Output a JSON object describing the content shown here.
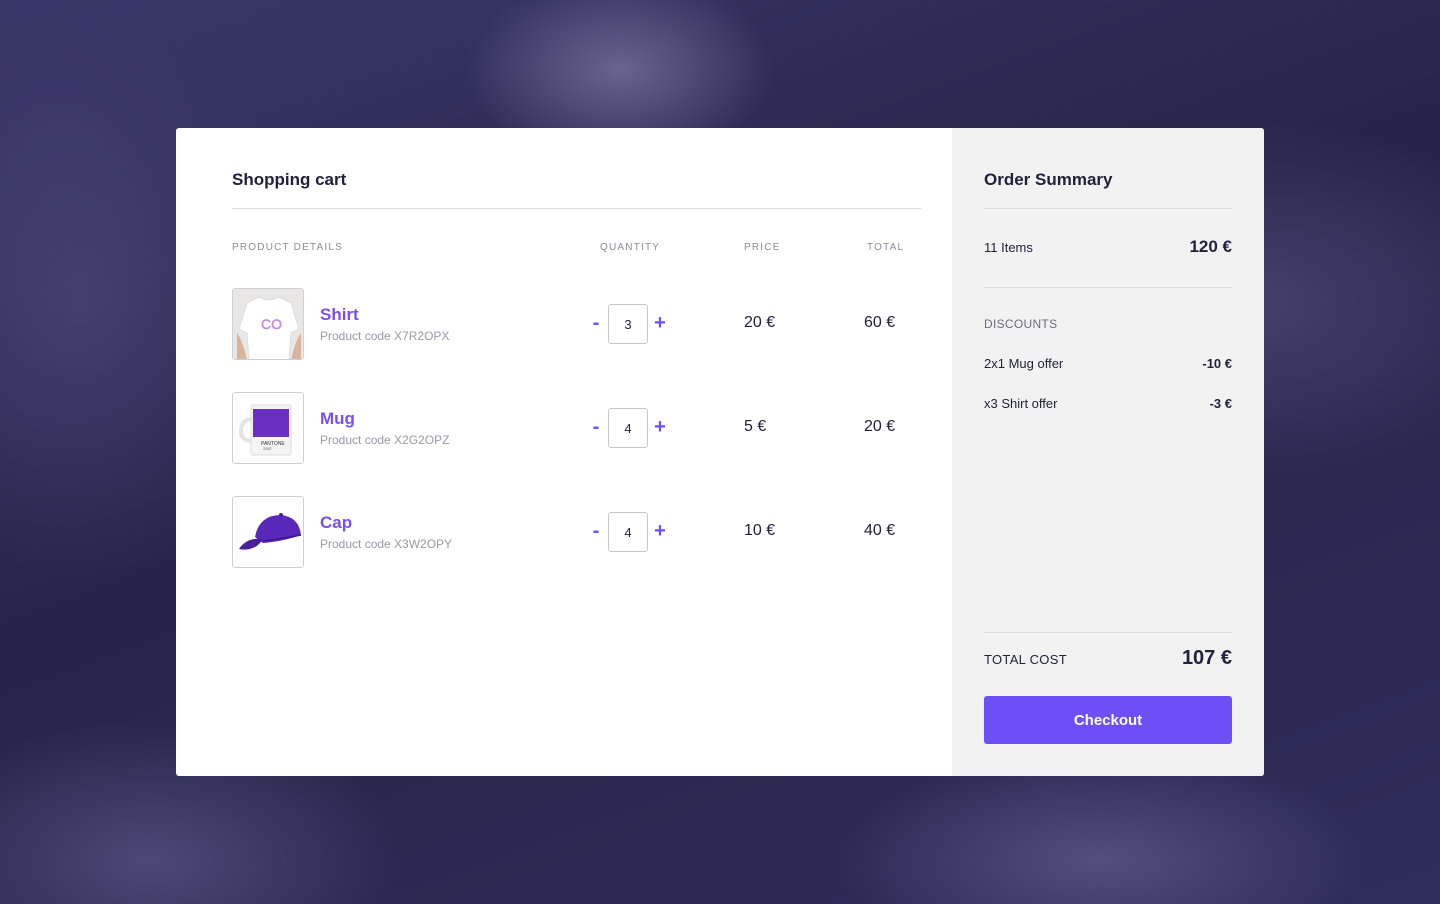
{
  "cart": {
    "title": "Shopping cart",
    "columns": {
      "product": "PRODUCT DETAILS",
      "quantity": "QUANTITY",
      "price": "PRICE",
      "total": "TOTAL"
    },
    "minus_label": "-",
    "plus_label": "+",
    "items": [
      {
        "name": "Shirt",
        "code": "Product code X7R2OPX",
        "quantity": "3",
        "price": "20 €",
        "total": "60 €",
        "image_icon": "tshirt-icon"
      },
      {
        "name": "Mug",
        "code": "Product code X2G2OPZ",
        "quantity": "4",
        "price": "5 €",
        "total": "20 €",
        "image_icon": "mug-icon"
      },
      {
        "name": "Cap",
        "code": "Product code X3W2OPY",
        "quantity": "4",
        "price": "10 €",
        "total": "40 €",
        "image_icon": "cap-icon"
      }
    ]
  },
  "summary": {
    "title": "Order Summary",
    "items_label": "11 Items",
    "items_value": "120 €",
    "discounts_header": "DISCOUNTS",
    "discounts": [
      {
        "label": "2x1 Mug offer",
        "value": "-10 €"
      },
      {
        "label": "x3 Shirt offer",
        "value": "-3 €"
      }
    ],
    "total_label": "TOTAL COST",
    "total_value": "107 €",
    "checkout_label": "Checkout"
  },
  "colors": {
    "accent": "#6c4ff5",
    "product_name": "#7c4df0",
    "background": "#2d2b55"
  }
}
